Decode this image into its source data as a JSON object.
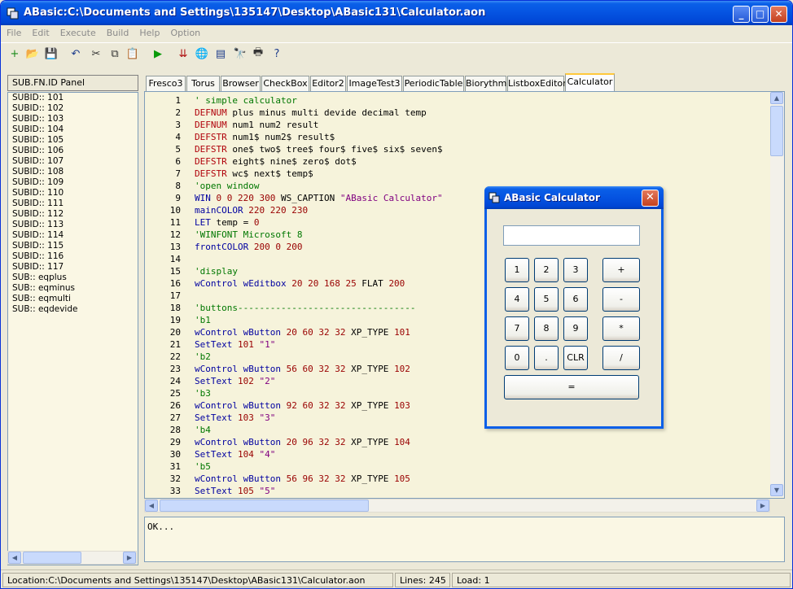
{
  "window": {
    "title": "ABasic:C:\\Documents and Settings\\135147\\Desktop\\ABasic131\\Calculator.aon",
    "controls": {
      "minimize": "_",
      "maximize": "□",
      "close": "✕"
    }
  },
  "menu": [
    "File",
    "Edit",
    "Execute",
    "Build",
    "Help",
    "Option"
  ],
  "toolbar": [
    {
      "name": "new-icon",
      "glyph": "+",
      "color": "#1A8A1A"
    },
    {
      "name": "open-icon",
      "glyph": "📂",
      "color": "#C89A2A"
    },
    {
      "name": "save-icon",
      "glyph": "💾",
      "color": "#1F3E8C"
    },
    {
      "name": "undo-icon",
      "glyph": "↶",
      "color": "#1F3E8C"
    },
    {
      "name": "cut-icon",
      "glyph": "✂",
      "color": "#333333"
    },
    {
      "name": "copy-icon",
      "glyph": "⧉",
      "color": "#333333"
    },
    {
      "name": "paste-icon",
      "glyph": "📋",
      "color": "#8A6A2A"
    },
    {
      "name": "run-icon",
      "glyph": "▶",
      "color": "#0A9A0A"
    },
    {
      "name": "build-icon",
      "glyph": "⇊",
      "color": "#B01010"
    },
    {
      "name": "globe-icon",
      "glyph": "🌐",
      "color": "#1F3E8C"
    },
    {
      "name": "document-icon",
      "glyph": "▤",
      "color": "#1F3E8C"
    },
    {
      "name": "find-icon",
      "glyph": "🔭",
      "color": "#333333"
    },
    {
      "name": "print-icon",
      "glyph": "🖶",
      "color": "#333333"
    },
    {
      "name": "help-icon",
      "glyph": "?",
      "color": "#1F3E8C"
    }
  ],
  "panel": {
    "title": "SUB.FN.ID Panel",
    "items": [
      "SUBID:: 101",
      "SUBID:: 102",
      "SUBID:: 103",
      "SUBID:: 104",
      "SUBID:: 105",
      "SUBID:: 106",
      "SUBID:: 107",
      "SUBID:: 108",
      "SUBID:: 109",
      "SUBID:: 110",
      "SUBID:: 111",
      "SUBID:: 112",
      "SUBID:: 113",
      "SUBID:: 114",
      "SUBID:: 115",
      "SUBID:: 116",
      "SUBID:: 117",
      "SUB:: eqplus",
      "SUB:: eqminus",
      "SUB:: eqmulti",
      "SUB:: eqdevide"
    ]
  },
  "tabs": [
    {
      "label": "Fresco3"
    },
    {
      "label": "Torus"
    },
    {
      "label": "Browser"
    },
    {
      "label": "CheckBox"
    },
    {
      "label": "Editor2"
    },
    {
      "label": "ImageTest3"
    },
    {
      "label": "PeriodicTable"
    },
    {
      "label": "Biorythm"
    },
    {
      "label": "ListboxEditor"
    },
    {
      "label": "Calculator",
      "active": true
    }
  ],
  "code": [
    [
      {
        "c": "cmt",
        "t": "' simple calculator"
      }
    ],
    [
      {
        "c": "kw-def",
        "t": "DEFNUM"
      },
      {
        "c": "",
        "t": " plus minus multi devide decimal temp"
      }
    ],
    [
      {
        "c": "kw-def",
        "t": "DEFNUM"
      },
      {
        "c": "",
        "t": " num1 num2 result"
      }
    ],
    [
      {
        "c": "kw-def",
        "t": "DEFSTR"
      },
      {
        "c": "",
        "t": " num1$ num2$ result$"
      }
    ],
    [
      {
        "c": "kw-def",
        "t": "DEFSTR"
      },
      {
        "c": "",
        "t": " one$ two$ tree$ four$ five$ six$ seven$"
      }
    ],
    [
      {
        "c": "kw-def",
        "t": "DEFSTR"
      },
      {
        "c": "",
        "t": " eight$ nine$ zero$ dot$"
      }
    ],
    [
      {
        "c": "kw-def",
        "t": "DEFSTR"
      },
      {
        "c": "",
        "t": " wc$ next$ temp$"
      }
    ],
    [
      {
        "c": "cmt",
        "t": "'open window"
      }
    ],
    [
      {
        "c": "kw-cmd",
        "t": "WIN"
      },
      {
        "c": "num",
        "t": " 0 0 220 300"
      },
      {
        "c": "",
        "t": " WS_CAPTION "
      },
      {
        "c": "str",
        "t": "\"ABasic Calculator\""
      }
    ],
    [
      {
        "c": "kw-cmd",
        "t": "mainCOLOR"
      },
      {
        "c": "num",
        "t": " 220 220 230"
      }
    ],
    [
      {
        "c": "kw-cmd",
        "t": "LET"
      },
      {
        "c": "",
        "t": " temp = "
      },
      {
        "c": "num",
        "t": "0"
      }
    ],
    [
      {
        "c": "cmt",
        "t": "'WINFONT Microsoft 8"
      }
    ],
    [
      {
        "c": "kw-cmd",
        "t": "frontCOLOR"
      },
      {
        "c": "num",
        "t": " 200 0 200"
      }
    ],
    [
      {
        "c": "",
        "t": ""
      }
    ],
    [
      {
        "c": "cmt",
        "t": "'display"
      }
    ],
    [
      {
        "c": "kw-cmd",
        "t": "wControl wEditbox"
      },
      {
        "c": "num",
        "t": " 20 20 168 25"
      },
      {
        "c": "",
        "t": " FLAT "
      },
      {
        "c": "num",
        "t": "200"
      }
    ],
    [
      {
        "c": "",
        "t": ""
      }
    ],
    [
      {
        "c": "cmt",
        "t": "'buttons---------------------------------"
      }
    ],
    [
      {
        "c": "cmt",
        "t": "'b1"
      }
    ],
    [
      {
        "c": "kw-cmd",
        "t": "wControl wButton"
      },
      {
        "c": "num",
        "t": " 20 60 32 32"
      },
      {
        "c": "",
        "t": " XP_TYPE "
      },
      {
        "c": "num",
        "t": "101"
      }
    ],
    [
      {
        "c": "kw-cmd",
        "t": "SetText"
      },
      {
        "c": "num",
        "t": " 101 "
      },
      {
        "c": "str",
        "t": "\"1\""
      }
    ],
    [
      {
        "c": "cmt",
        "t": "'b2"
      }
    ],
    [
      {
        "c": "kw-cmd",
        "t": "wControl wButton"
      },
      {
        "c": "num",
        "t": " 56 60 32 32"
      },
      {
        "c": "",
        "t": " XP_TYPE "
      },
      {
        "c": "num",
        "t": "102"
      }
    ],
    [
      {
        "c": "kw-cmd",
        "t": "SetText"
      },
      {
        "c": "num",
        "t": " 102 "
      },
      {
        "c": "str",
        "t": "\"2\""
      }
    ],
    [
      {
        "c": "cmt",
        "t": "'b3"
      }
    ],
    [
      {
        "c": "kw-cmd",
        "t": "wControl wButton"
      },
      {
        "c": "num",
        "t": " 92 60 32 32"
      },
      {
        "c": "",
        "t": " XP_TYPE "
      },
      {
        "c": "num",
        "t": "103"
      }
    ],
    [
      {
        "c": "kw-cmd",
        "t": "SetText"
      },
      {
        "c": "num",
        "t": " 103 "
      },
      {
        "c": "str",
        "t": "\"3\""
      }
    ],
    [
      {
        "c": "cmt",
        "t": "'b4"
      }
    ],
    [
      {
        "c": "kw-cmd",
        "t": "wControl wButton"
      },
      {
        "c": "num",
        "t": " 20 96 32 32"
      },
      {
        "c": "",
        "t": " XP_TYPE "
      },
      {
        "c": "num",
        "t": "104"
      }
    ],
    [
      {
        "c": "kw-cmd",
        "t": "SetText"
      },
      {
        "c": "num",
        "t": " 104 "
      },
      {
        "c": "str",
        "t": "\"4\""
      }
    ],
    [
      {
        "c": "cmt",
        "t": "'b5"
      }
    ],
    [
      {
        "c": "kw-cmd",
        "t": "wControl wButton"
      },
      {
        "c": "num",
        "t": " 56 96 32 32"
      },
      {
        "c": "",
        "t": " XP_TYPE "
      },
      {
        "c": "num",
        "t": "105"
      }
    ],
    [
      {
        "c": "kw-cmd",
        "t": "SetText"
      },
      {
        "c": "num",
        "t": " 105 "
      },
      {
        "c": "str",
        "t": "\"5\""
      }
    ]
  ],
  "output": "OK...",
  "status": {
    "location": "Location:C:\\Documents and Settings\\135147\\Desktop\\ABasic131\\Calculator.aon",
    "lines": "Lines: 245",
    "load": "Load: 1"
  },
  "calculator": {
    "title": "ABasic Calculator",
    "display_value": "",
    "buttons": [
      "1",
      "2",
      "3",
      "+",
      "4",
      "5",
      "6",
      "-",
      "7",
      "8",
      "9",
      "*",
      "0",
      ".",
      "CLR",
      "/",
      "="
    ]
  }
}
